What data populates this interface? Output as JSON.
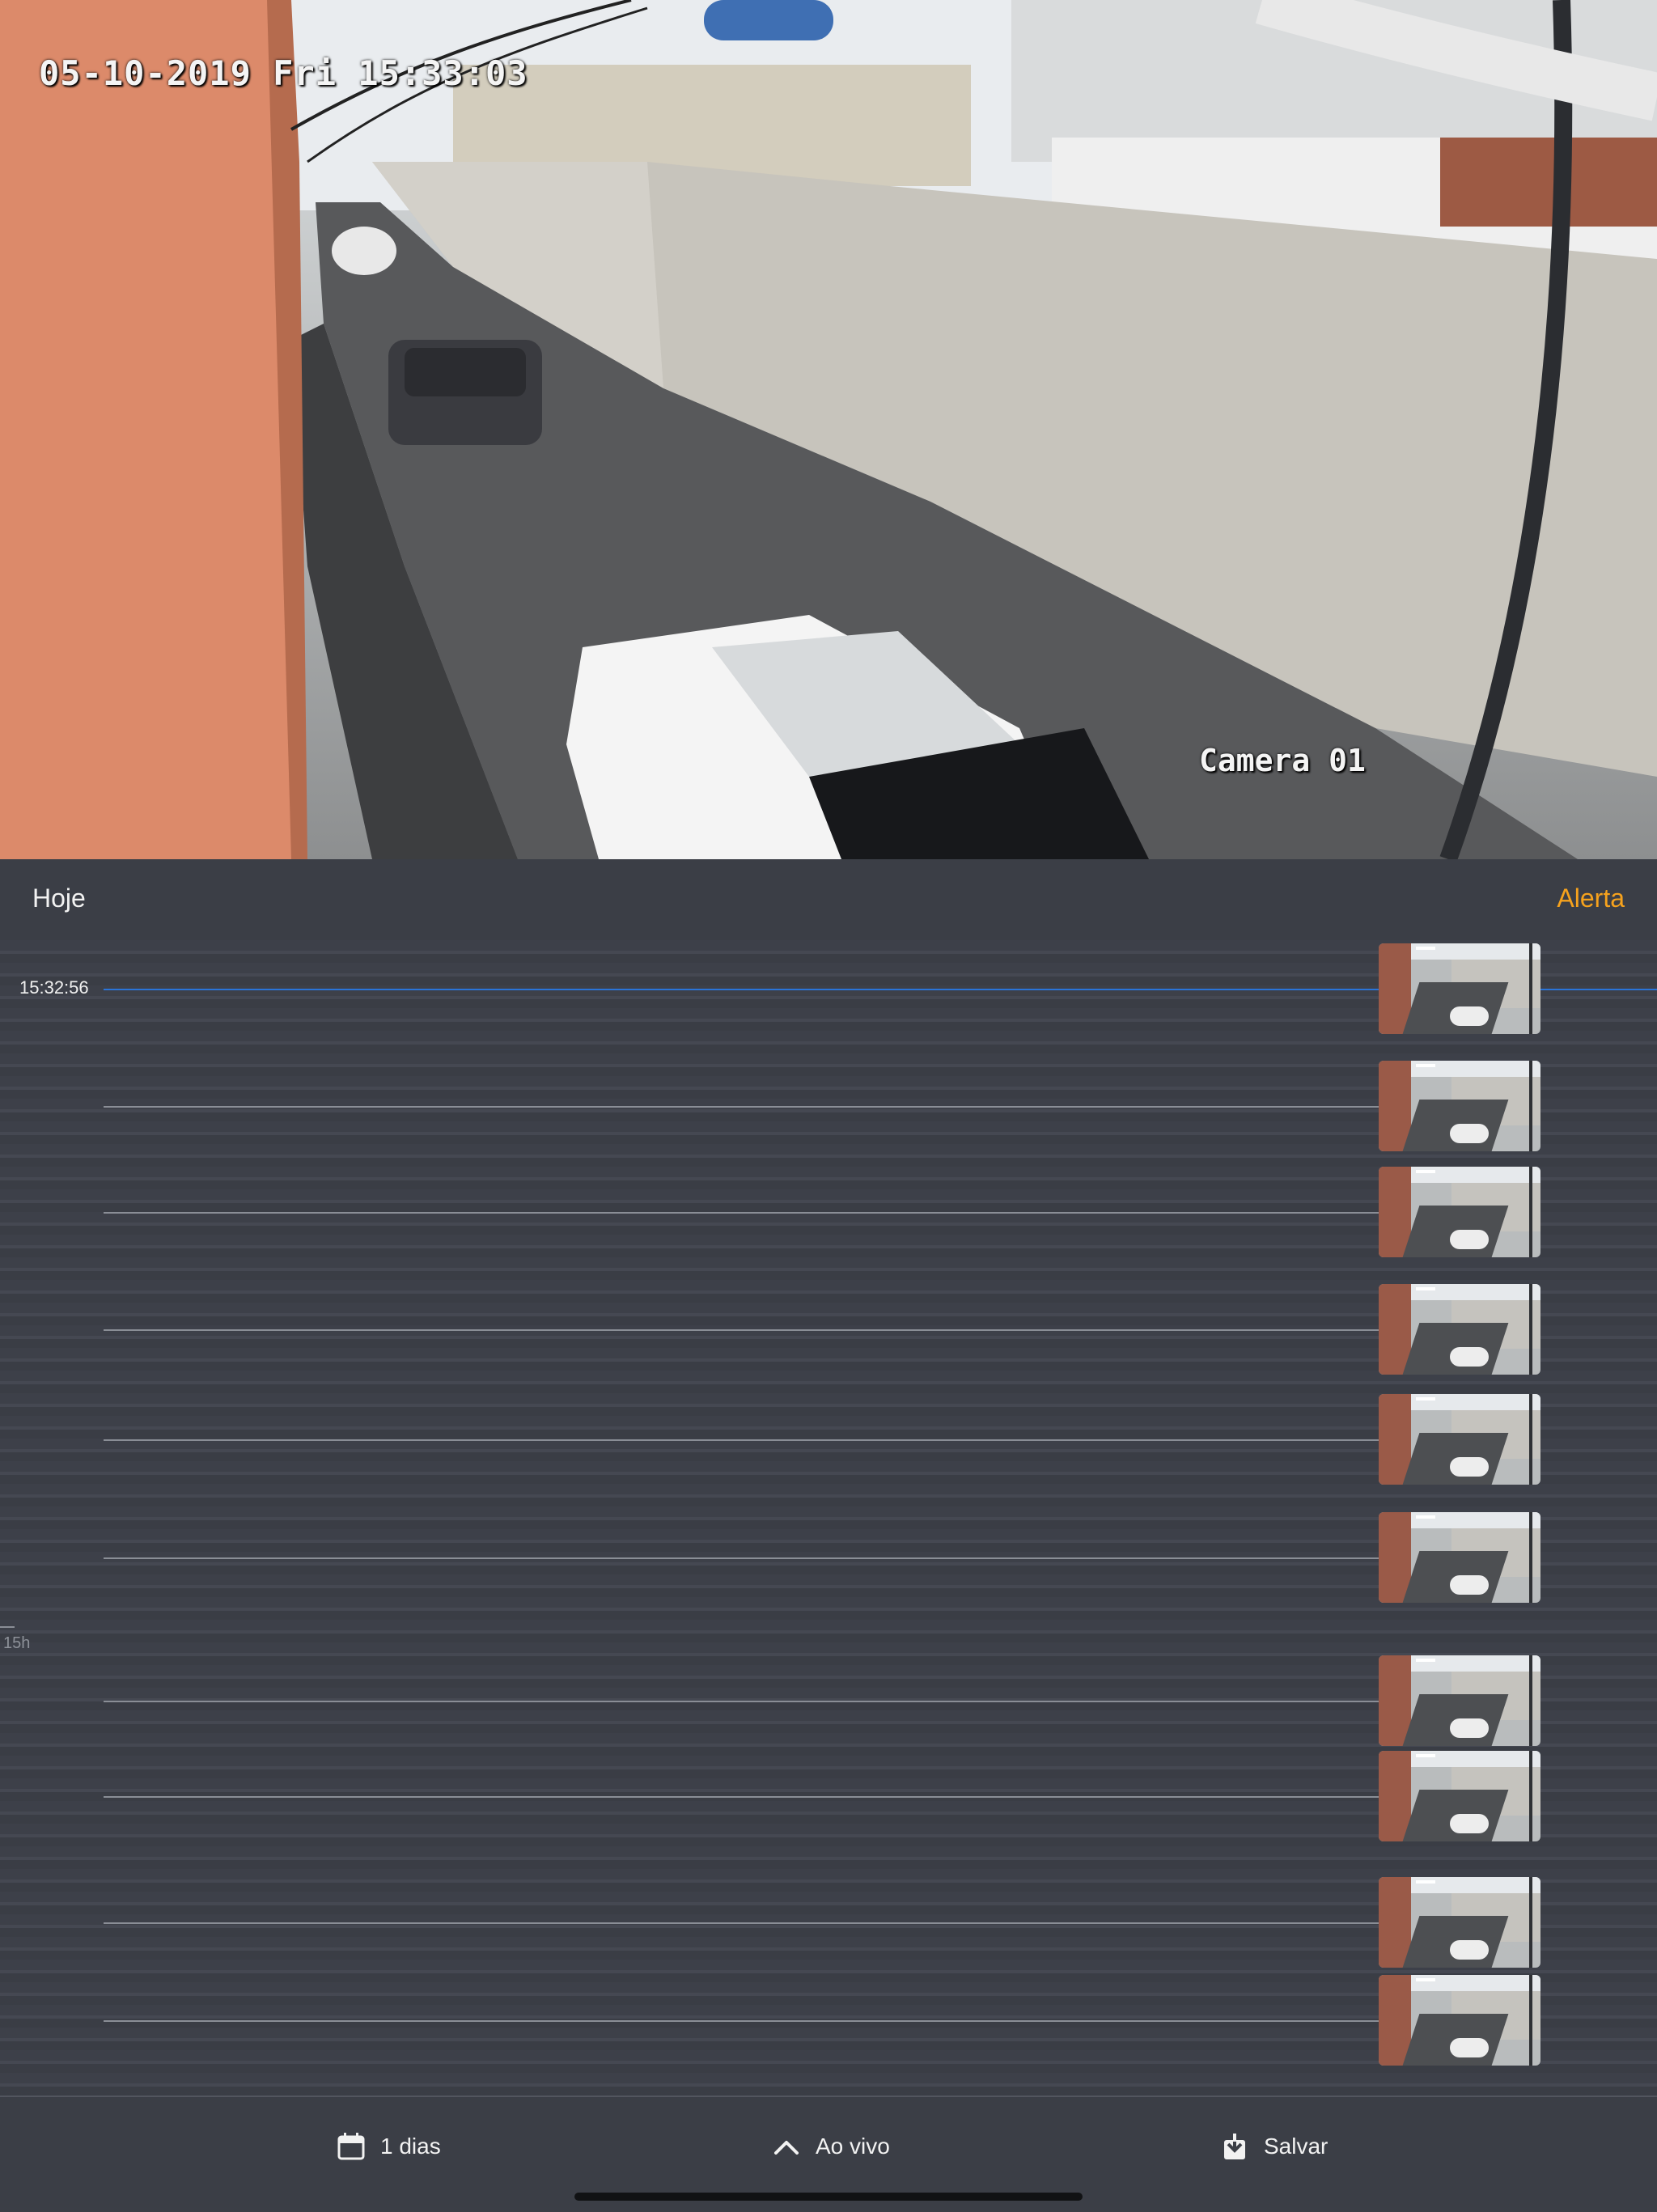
{
  "video": {
    "timestamp_overlay": "05-10-2019 Fri 15:33:03",
    "camera_label": "Camera 01"
  },
  "header": {
    "left_label": "Hoje",
    "right_label": "Alerta"
  },
  "timeline": {
    "current_time": "15:32:56",
    "hour_label": "15h",
    "event_thumbnail_count": 10
  },
  "toolbar": {
    "days_label": "1 dias",
    "live_label": "Ao vivo",
    "save_label": "Salvar",
    "days_icon": "calendar-icon",
    "live_icon": "chevron-up-icon",
    "save_icon": "download-icon"
  },
  "colors": {
    "background": "#3b3e46",
    "accent_alert": "#f6a21d",
    "now_line": "#2a74d8"
  }
}
